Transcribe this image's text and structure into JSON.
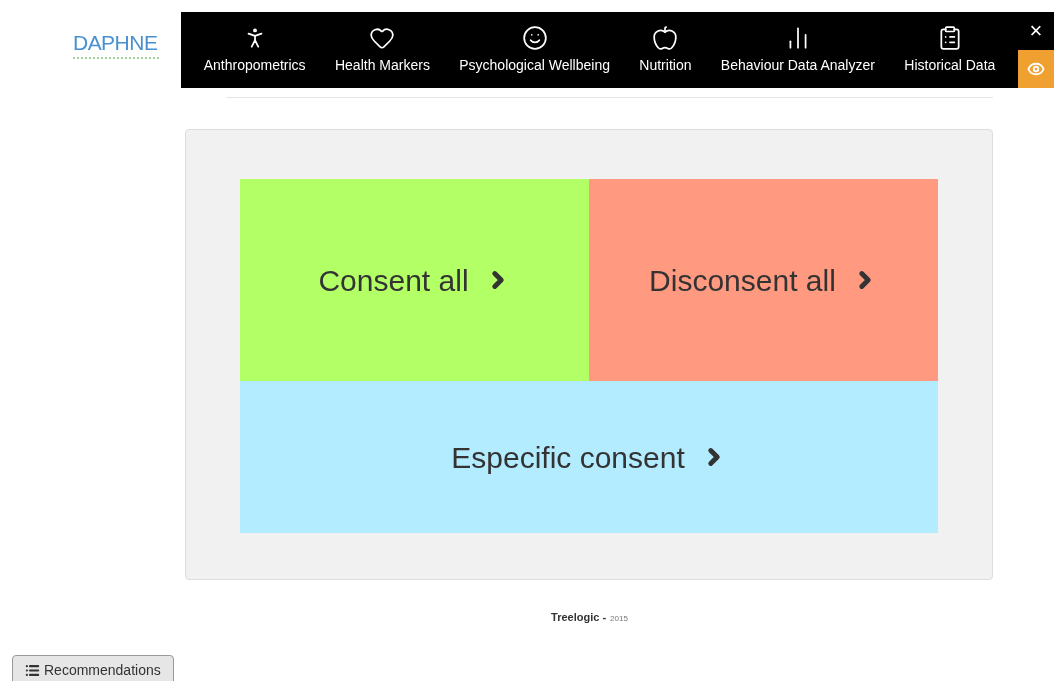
{
  "logo": "DAPHNE",
  "nav": [
    {
      "label": "Anthropometrics",
      "kind": "person"
    },
    {
      "label": "Health Markers",
      "kind": "heart"
    },
    {
      "label": "Psychological Wellbeing",
      "kind": "smile"
    },
    {
      "label": "Nutrition",
      "kind": "apple"
    },
    {
      "label": "Behaviour Data Analyzer",
      "kind": "chart"
    },
    {
      "label": "Historical Data",
      "kind": "clipboard"
    }
  ],
  "close": "×",
  "tiles": [
    {
      "label": "Consent all",
      "color": "#b3ff66"
    },
    {
      "label": "Disconsent all",
      "color": "#ff9980"
    },
    {
      "label": "Especific consent",
      "color": "#b3ecff"
    }
  ],
  "footer": {
    "company": "Treelogic -",
    "year": "2015"
  },
  "recommendations_button": "Recommendations"
}
